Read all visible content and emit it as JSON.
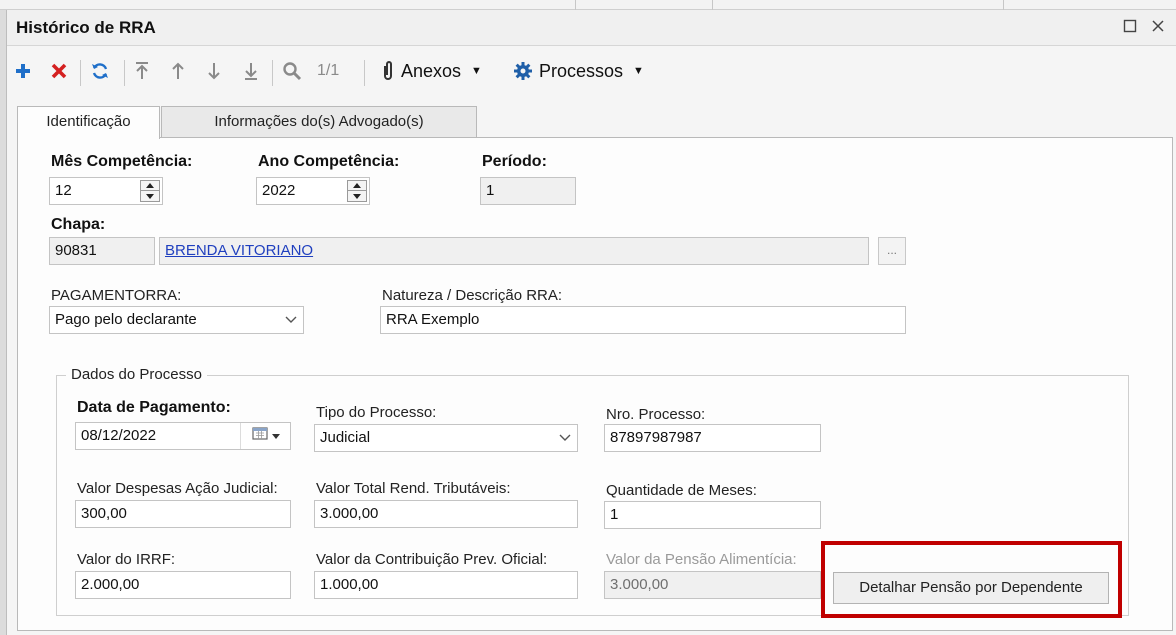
{
  "window": {
    "title": "Histórico de RRA"
  },
  "toolbar": {
    "pager": "1/1",
    "anexos_label": "Anexos",
    "processos_label": "Processos"
  },
  "tabs": [
    {
      "label": "Identificação",
      "active": true
    },
    {
      "label": "Informações do(s) Advogado(s)",
      "active": false
    }
  ],
  "form": {
    "mes_competencia": {
      "label": "Mês Competência:",
      "value": "12"
    },
    "ano_competencia": {
      "label": "Ano Competência:",
      "value": "2022"
    },
    "periodo": {
      "label": "Período:",
      "value": "1"
    },
    "chapa": {
      "label": "Chapa:",
      "code": "90831",
      "name": "BRENDA VITORIANO",
      "lookup_label": "..."
    },
    "pagamento_rra": {
      "label": "PAGAMENTORRA:",
      "value": "Pago pelo declarante"
    },
    "natureza": {
      "label": "Natureza / Descrição RRA:",
      "value": "RRA Exemplo"
    }
  },
  "processo": {
    "group_title": "Dados do Processo",
    "data_pagamento": {
      "label": "Data de Pagamento:",
      "value": "08/12/2022"
    },
    "tipo_processo": {
      "label": "Tipo do Processo:",
      "value": "Judicial"
    },
    "nro_processo": {
      "label": "Nro. Processo:",
      "value": "87897987987"
    },
    "despesas": {
      "label": "Valor Despesas Ação Judicial:",
      "value": "300,00"
    },
    "rend_tributaveis": {
      "label": "Valor Total Rend. Tributáveis:",
      "value": "3.000,00"
    },
    "qtd_meses": {
      "label": "Quantidade de Meses:",
      "value": "1"
    },
    "irrf": {
      "label": "Valor do IRRF:",
      "value": "2.000,00"
    },
    "contrib_prev": {
      "label": "Valor da Contribuição Prev. Oficial:",
      "value": "1.000,00"
    },
    "pensao": {
      "label": "Valor da Pensão Alimentícia:",
      "value": "3.000,00"
    },
    "detalhar_button": "Detalhar Pensão por Dependente"
  },
  "colors": {
    "accent_blue": "#1f6fc9",
    "delete_red": "#d42020",
    "highlight_red": "#c00000",
    "link_blue": "#1f3fbf"
  },
  "icons": [
    "add-icon",
    "delete-icon",
    "refresh-icon",
    "first-record-icon",
    "previous-record-icon",
    "next-record-icon",
    "last-record-icon",
    "search-icon",
    "paperclip-icon",
    "gear-icon",
    "calendar-icon"
  ]
}
